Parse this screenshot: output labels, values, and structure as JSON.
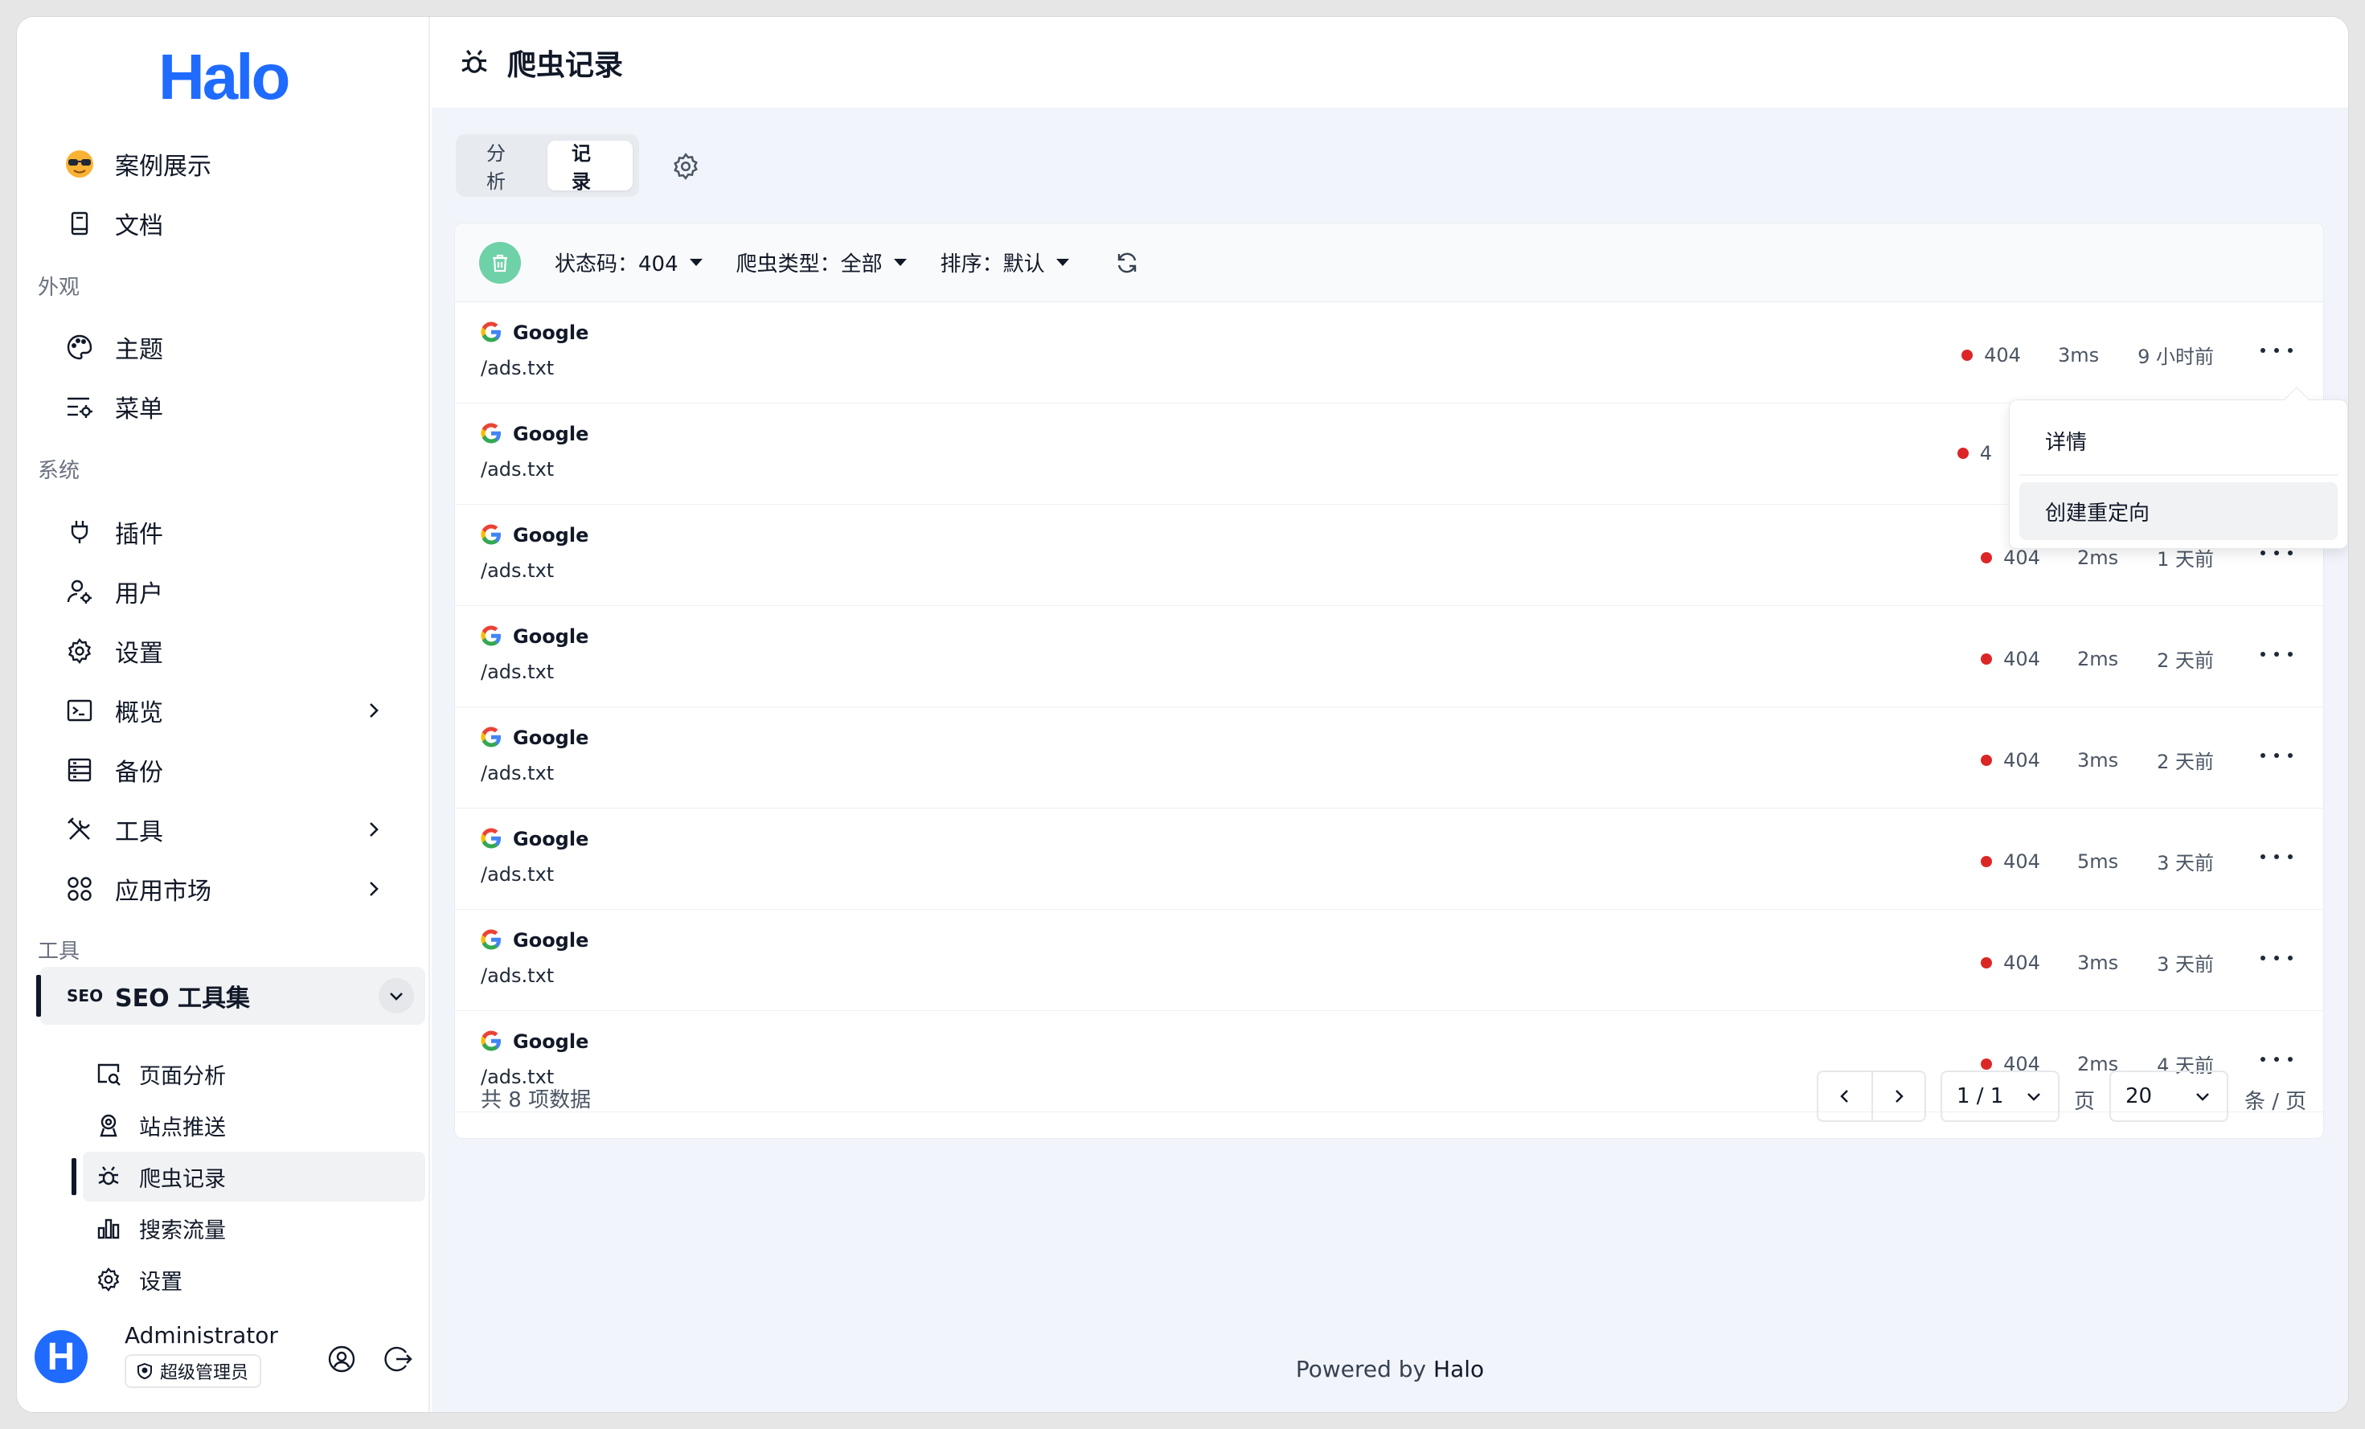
{
  "app": {
    "logo_text": "Halo",
    "brand_color": "#1f6bff",
    "accent_color": "#dc2626"
  },
  "sidebar": {
    "top_items": [
      {
        "label": "案例展示",
        "icon": "sunglasses-emoji-icon"
      },
      {
        "label": "文档",
        "icon": "book-icon"
      }
    ],
    "groups": {
      "appearance": "外观",
      "system": "系统",
      "tools": "工具"
    },
    "appearance_items": [
      {
        "label": "主题",
        "icon": "palette-icon"
      },
      {
        "label": "菜单",
        "icon": "menu-settings-icon"
      }
    ],
    "system_items": [
      {
        "label": "插件",
        "icon": "plug-icon"
      },
      {
        "label": "用户",
        "icon": "user-gear-icon"
      },
      {
        "label": "设置",
        "icon": "gear-icon"
      },
      {
        "label": "概览",
        "icon": "terminal-icon"
      },
      {
        "label": "备份",
        "icon": "archive-icon"
      },
      {
        "label": "工具",
        "icon": "tools-icon"
      },
      {
        "label": "应用市场",
        "icon": "apps-grid-icon"
      }
    ],
    "seo_group": {
      "tag": "SEO",
      "label": "SEO 工具集",
      "items": [
        {
          "label": "页面分析",
          "icon": "page-search-icon"
        },
        {
          "label": "站点推送",
          "icon": "webcam-icon"
        },
        {
          "label": "爬虫记录",
          "icon": "bug-icon",
          "active": true
        },
        {
          "label": "搜索流量",
          "icon": "bar-chart-icon"
        },
        {
          "label": "设置",
          "icon": "gear-icon"
        }
      ]
    },
    "user": {
      "avatar_letter": "H",
      "name": "Administrator",
      "role": "超级管理员"
    }
  },
  "main": {
    "title": "爬虫记录",
    "tabs": [
      {
        "label": "分析",
        "active": false
      },
      {
        "label": "记录",
        "active": true
      }
    ],
    "filters": {
      "status": "状态码：404",
      "crawler_type": "爬虫类型：全部",
      "sort": "排序：默认"
    },
    "records": [
      {
        "name": "Google",
        "path": "/ads.txt",
        "code": "404",
        "duration": "3ms",
        "time": "9 小时前"
      },
      {
        "name": "Google",
        "path": "/ads.txt",
        "code": "404",
        "duration": "",
        "time": ""
      },
      {
        "name": "Google",
        "path": "/ads.txt",
        "code": "404",
        "duration": "2ms",
        "time": "1 天前"
      },
      {
        "name": "Google",
        "path": "/ads.txt",
        "code": "404",
        "duration": "2ms",
        "time": "2 天前"
      },
      {
        "name": "Google",
        "path": "/ads.txt",
        "code": "404",
        "duration": "3ms",
        "time": "2 天前"
      },
      {
        "name": "Google",
        "path": "/ads.txt",
        "code": "404",
        "duration": "5ms",
        "time": "3 天前"
      },
      {
        "name": "Google",
        "path": "/ads.txt",
        "code": "404",
        "duration": "3ms",
        "time": "3 天前"
      },
      {
        "name": "Google",
        "path": "/ads.txt",
        "code": "404",
        "duration": "2ms",
        "time": "4 天前"
      }
    ],
    "row2_partial_code": "4",
    "pagination": {
      "total": "共 8 项数据",
      "page_value": "1 / 1",
      "page_unit": "页",
      "size_value": "20",
      "size_unit": "条 / 页"
    },
    "dropdown": {
      "items": [
        "详情",
        "创建重定向"
      ]
    },
    "footer": {
      "prefix": "Powered by ",
      "brand": "Halo"
    }
  }
}
